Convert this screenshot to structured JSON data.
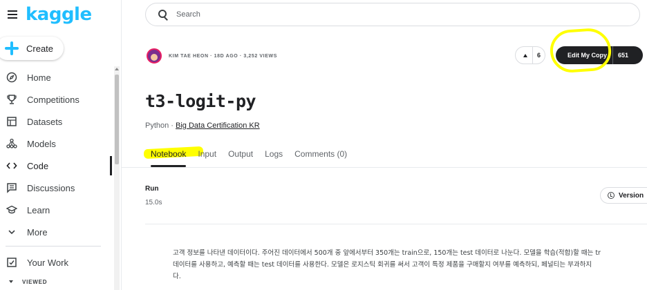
{
  "brand": {
    "logo_text": "kaggle",
    "color": "#20beff"
  },
  "sidebar": {
    "create_label": "Create",
    "items": [
      {
        "label": "Home",
        "icon": "compass-icon"
      },
      {
        "label": "Competitions",
        "icon": "trophy-icon"
      },
      {
        "label": "Datasets",
        "icon": "table-icon"
      },
      {
        "label": "Models",
        "icon": "models-icon"
      },
      {
        "label": "Code",
        "icon": "code-icon",
        "active": true
      },
      {
        "label": "Discussions",
        "icon": "discussions-icon"
      },
      {
        "label": "Learn",
        "icon": "graduation-cap-icon"
      },
      {
        "label": "More",
        "icon": "chevron-down-icon"
      },
      {
        "label": "Your Work",
        "icon": "your-work-icon"
      }
    ],
    "viewed_label": "VIEWED"
  },
  "search": {
    "placeholder": "Search"
  },
  "notebook": {
    "author_meta": "KIM TAE HEON · 18D AGO · 3,252 VIEWS",
    "vote_count": "6",
    "edit_label": "Edit My Copy",
    "edit_count": "651",
    "title": "t3-logit-py",
    "language": "Python · ",
    "dataset_link": "Big Data Certification KR",
    "tabs": [
      "Notebook",
      "Input",
      "Output",
      "Logs",
      "Comments (0)"
    ],
    "run_label": "Run",
    "run_value": "15.0s",
    "version_label": "Version",
    "description_lines": [
      "고객 정보를 나타낸 데이터이다. 주어진 데이터에서 500개 중 앞에서부터 350개는 train으로, 150개는 test 데이터로 나눈다. 모델을 학습(적합)할 때는 tr",
      "데이터를 사용하고, 예측할 때는 test 데이터를 사용한다. 모델은 로지스틱 회귀를 써서 고객이 특정 제품을 구매할지 여부를 예측하되, 페널티는 부과하지",
      "다."
    ]
  },
  "colors": {
    "highlight": "#ffff00",
    "dark_button": "#202124"
  }
}
